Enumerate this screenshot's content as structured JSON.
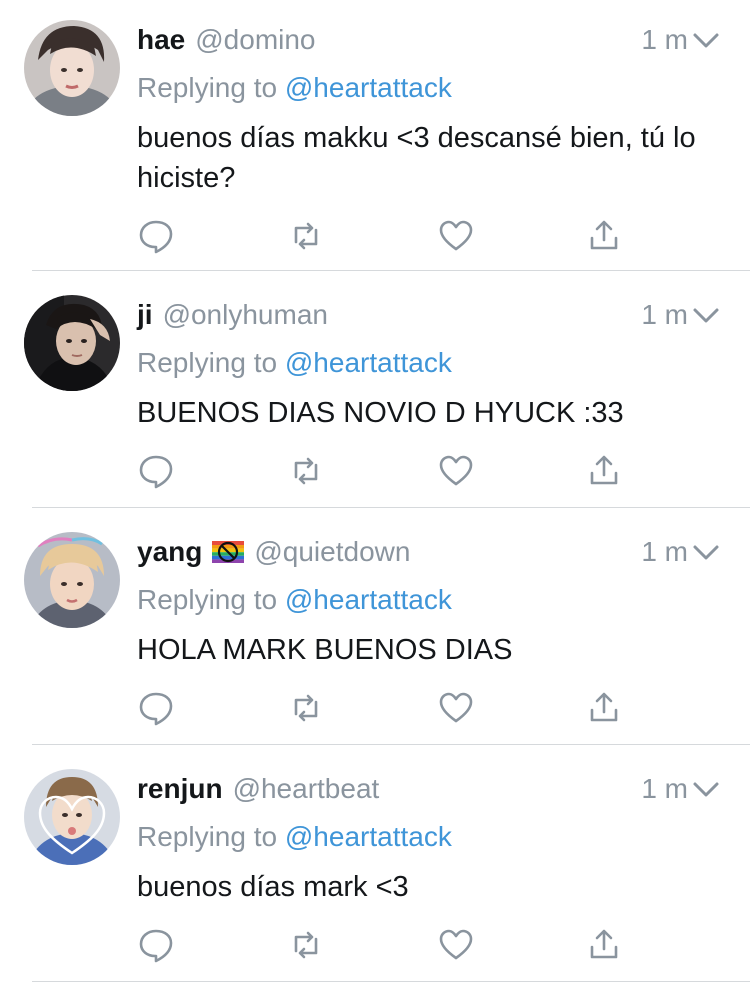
{
  "tweets": [
    {
      "display_name": "hae",
      "handle": "@domino",
      "time": "1 m",
      "reply_prefix": "Replying to",
      "reply_handle": "@heartattack",
      "text": "buenos días makku <3 descansé bien, tú lo hiciste?",
      "avatar_icon": "avatar-photo",
      "has_flag": false
    },
    {
      "display_name": "ji",
      "handle": "@onlyhuman",
      "time": "1 m",
      "reply_prefix": "Replying to",
      "reply_handle": "@heartattack",
      "text": "BUENOS DIAS NOVIO D HYUCK :33",
      "avatar_icon": "avatar-photo",
      "has_flag": false
    },
    {
      "display_name": "yang",
      "handle": "@quietdown",
      "time": "1 m",
      "reply_prefix": "Replying to",
      "reply_handle": "@heartattack",
      "text": "HOLA MARK BUENOS DIAS",
      "avatar_icon": "avatar-photo",
      "has_flag": true,
      "flag_icon": "rainbow-flag-no-sign-icon"
    },
    {
      "display_name": "renjun",
      "handle": "@heartbeat",
      "time": "1 m",
      "reply_prefix": "Replying to",
      "reply_handle": "@heartattack",
      "text": "buenos días mark <3",
      "avatar_icon": "avatar-photo",
      "has_flag": false
    }
  ],
  "actions": [
    "reply-icon",
    "retweet-icon",
    "like-icon",
    "share-icon"
  ],
  "colors": {
    "link": "#3f95d8",
    "muted": "#8a949e",
    "text": "#14171a",
    "icon": "#8a949e",
    "divider": "#d6d9dc"
  }
}
